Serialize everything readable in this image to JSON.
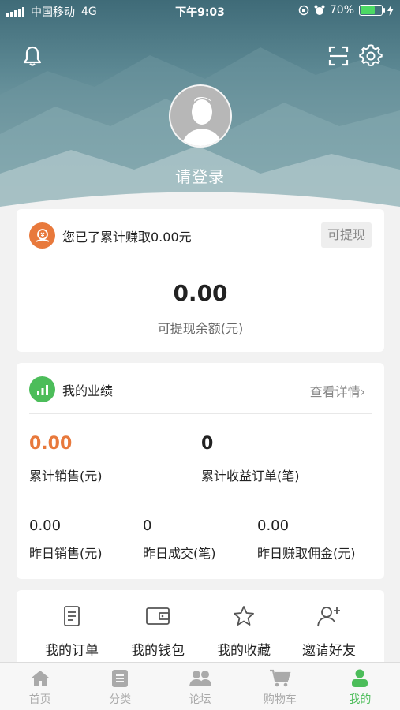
{
  "status_bar": {
    "carrier": "中国移动",
    "network": "4G",
    "time": "下午9:03",
    "battery_percent": "70%",
    "battery_level": 0.7
  },
  "header": {
    "notification_icon": "bell-icon",
    "scan_icon": "scan-icon",
    "settings_icon": "gear-icon",
    "login_text": "请登录"
  },
  "earnings_card": {
    "title": "您已了累计赚取0.00元",
    "withdraw_button": "可提现",
    "balance": "0.00",
    "balance_label": "可提现余额(元)"
  },
  "performance_card": {
    "title": "我的业绩",
    "details_link": "查看详情",
    "total_sales_value": "0.00",
    "total_sales_label": "累计销售(元)",
    "total_orders_value": "0",
    "total_orders_label": "累计收益订单(笔)",
    "yesterday_sales_value": "0.00",
    "yesterday_sales_label": "昨日销售(元)",
    "yesterday_deals_value": "0",
    "yesterday_deals_label": "昨日成交(笔)",
    "yesterday_commission_value": "0.00",
    "yesterday_commission_label": "昨日赚取佣金(元)"
  },
  "quick_menu": [
    {
      "label": "我的订单",
      "icon": "order-icon"
    },
    {
      "label": "我的钱包",
      "icon": "wallet-icon"
    },
    {
      "label": "我的收藏",
      "icon": "star-icon"
    },
    {
      "label": "邀请好友",
      "icon": "add-user-icon"
    }
  ],
  "tabs": [
    {
      "label": "首页",
      "icon": "home-icon"
    },
    {
      "label": "分类",
      "icon": "list-icon"
    },
    {
      "label": "论坛",
      "icon": "people-icon"
    },
    {
      "label": "购物车",
      "icon": "cart-icon"
    },
    {
      "label": "我的",
      "icon": "person-icon",
      "active": true
    }
  ],
  "colors": {
    "accent_green": "#4cbd5a",
    "accent_orange": "#e8793c",
    "tab_inactive": "#aaaaaa"
  }
}
